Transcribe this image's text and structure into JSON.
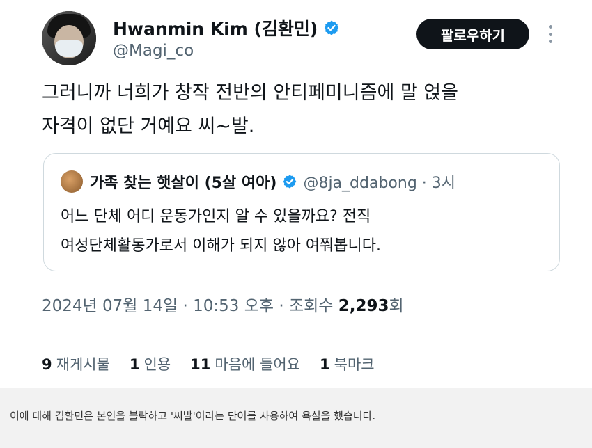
{
  "author": {
    "name": "Hwanmin Kim (김환민)",
    "handle": "@Magi_co"
  },
  "follow_button": "팔로우하기",
  "tweet": {
    "line1": "그러니까 너희가 창작 전반의 안티페미니즘에 말 얹을",
    "line2": "자격이 없단 거예요 씨~발."
  },
  "quoted": {
    "name": "가족 찾는 햇살이 (5살 여아)",
    "handle": "@8ja_ddabong · 3시",
    "line1": "어느 단체 어디 운동가인지 알 수 있을까요? 전직",
    "line2": "여성단체활동가로서 이해가 되지 않아 여쭤봅니다."
  },
  "meta": {
    "datetime": "2024년 07월 14일 · 10:53 오후 · 조회수 ",
    "views": "2,293",
    "views_suffix": "회"
  },
  "stats": [
    {
      "count": "9",
      "label": "재게시물"
    },
    {
      "count": "1",
      "label": "인용"
    },
    {
      "count": "11",
      "label": "마음에 들어요"
    },
    {
      "count": "1",
      "label": "북마크"
    }
  ],
  "caption": "이에 대해 김환민은 본인을 블락하고 '씨발'이라는 단어를 사용하여 욕설을 했습니다.",
  "colors": {
    "verified": "#1d9bf0",
    "follow_bg": "#0f1419",
    "secondary_text": "#536471"
  },
  "icons": {
    "verified": "verified-badge-icon",
    "more": "more-options-icon"
  }
}
